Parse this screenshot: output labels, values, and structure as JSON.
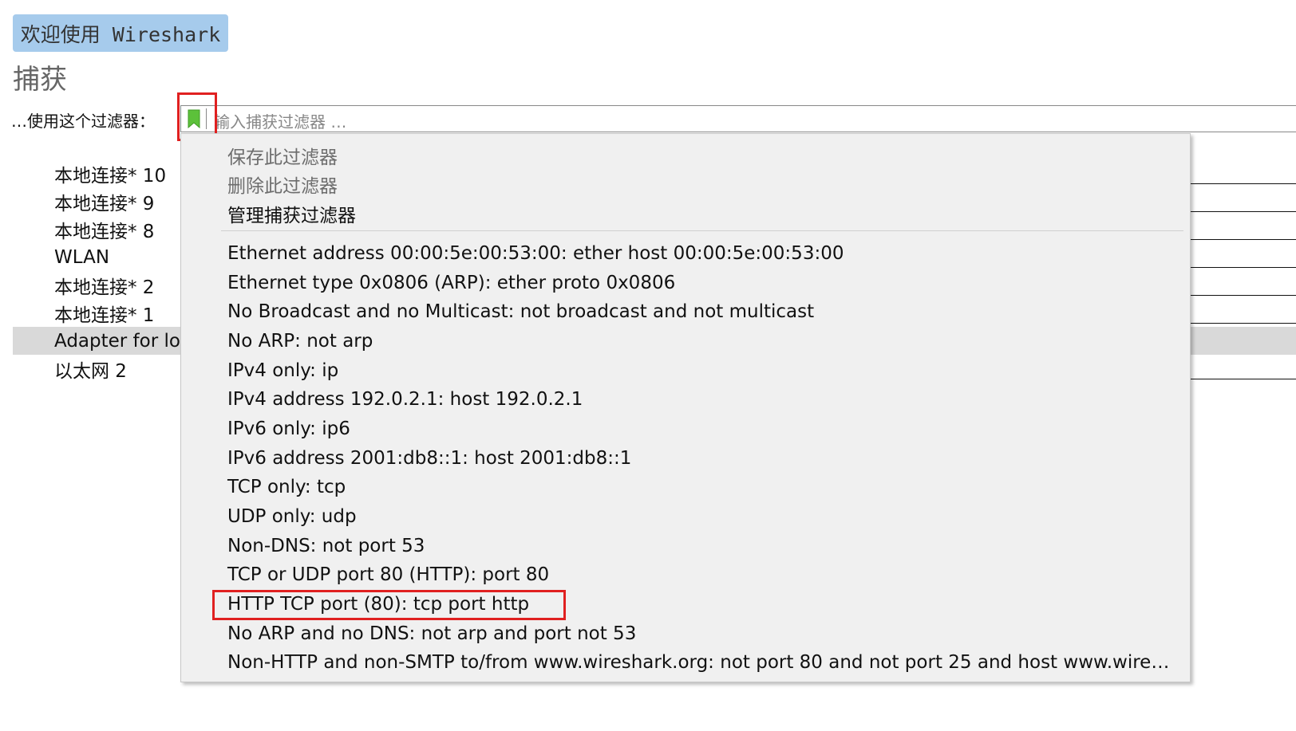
{
  "header": {
    "welcome_button": "欢迎使用 Wireshark",
    "section_title": "捕获"
  },
  "filter": {
    "label": "…使用这个过滤器：",
    "placeholder": "输入捕获过滤器 …",
    "bookmark_icon": "bookmark-icon",
    "bookmark_color": "#5cc13a"
  },
  "interfaces": [
    {
      "name": "本地连接* 10"
    },
    {
      "name": "本地连接* 9"
    },
    {
      "name": "本地连接* 8"
    },
    {
      "name": "WLAN"
    },
    {
      "name": "本地连接* 2"
    },
    {
      "name": "本地连接* 1"
    },
    {
      "name": "Adapter for lo",
      "selected": true
    },
    {
      "name": "以太网 2"
    }
  ],
  "menu": {
    "actions": [
      {
        "label": "保存此过滤器",
        "enabled": false
      },
      {
        "label": "删除此过滤器",
        "enabled": false
      },
      {
        "label": "管理捕获过滤器",
        "enabled": true
      }
    ],
    "filters": [
      "Ethernet address 00:00:5e:00:53:00: ether host 00:00:5e:00:53:00",
      "Ethernet type 0x0806 (ARP): ether proto 0x0806",
      "No Broadcast and no Multicast: not broadcast and not multicast",
      "No ARP: not arp",
      "IPv4 only: ip",
      "IPv4 address 192.0.2.1: host 192.0.2.1",
      "IPv6 only: ip6",
      "IPv6 address 2001:db8::1: host 2001:db8::1",
      "TCP only: tcp",
      "UDP only: udp",
      "Non-DNS: not port 53",
      "TCP or UDP port 80 (HTTP): port 80",
      "HTTP TCP port (80): tcp port http",
      "No ARP and no DNS: not arp and port not 53",
      "Non-HTTP and non-SMTP to/from www.wireshark.org: not port 80 and not port 25 and host www.wire…"
    ],
    "highlighted_filter": "HTTP TCP port (80): tcp port http"
  },
  "colors": {
    "welcome_bg": "#a6cbec",
    "highlight": "#e02020",
    "selected_row": "#d9d9d9"
  }
}
